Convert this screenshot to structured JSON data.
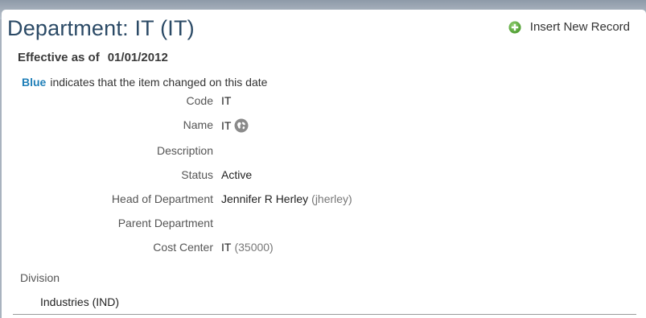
{
  "header": {
    "title": "Department: IT (IT)",
    "insert_label": "Insert New Record"
  },
  "effective": {
    "prefix": "Effective as of",
    "date": "01/01/2012"
  },
  "legend": {
    "blue_word": "Blue",
    "text": "indicates that the item changed on this date"
  },
  "fields": {
    "code": {
      "label": "Code",
      "value": "IT"
    },
    "name": {
      "label": "Name",
      "value": "IT",
      "icon": "globe-icon"
    },
    "description": {
      "label": "Description",
      "value": ""
    },
    "status": {
      "label": "Status",
      "value": "Active"
    },
    "head": {
      "label": "Head of Department",
      "value": "Jennifer R Herley",
      "secondary": "(jherley)"
    },
    "parent": {
      "label": "Parent Department",
      "value": ""
    },
    "cost_center": {
      "label": "Cost Center",
      "value": "IT",
      "secondary": "(35000)"
    }
  },
  "division": {
    "label": "Division",
    "value": "Industries (IND)"
  },
  "colors": {
    "title": "#2b4a66",
    "blue_accent": "#1f7fb8",
    "plus_icon": "#5fae3c"
  }
}
